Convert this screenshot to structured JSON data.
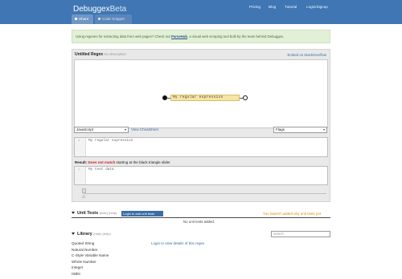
{
  "header": {
    "brand_main": "Debuggex",
    "brand_beta": "Beta",
    "nav": [
      "Pricing",
      "Blog",
      "Tutorial",
      "Login/Signup"
    ],
    "tabs": {
      "share": "Share",
      "code": "Code Snippet"
    }
  },
  "promo": {
    "before": "Using regexes for extracting data from web pages? Check out ",
    "link": "ParseHub",
    "after": ", a visual web scraping tool built by the team behind Debuggex."
  },
  "regex_panel": {
    "title": "Untitled Regex",
    "description": "No description",
    "embed_link": "Embed on StackOverflow",
    "railroad_text": "My regular expression",
    "flavor": "JavaScript",
    "cheatsheet": "View Cheatsheet",
    "flags": "Flags",
    "line_number": "1",
    "regex_text": "My regular expression",
    "result_label": "Result:",
    "result_status": "Does not match",
    "result_suffix": " starting at the black triangle slider",
    "test_text": "My test data"
  },
  "unit_tests": {
    "title": "Unit Tests",
    "help": "(hide) (help)",
    "add_button": "Login to add unit tests",
    "warning": "You haven't added any unit tests yet",
    "empty_text": "No unit tests added."
  },
  "library": {
    "title": "Library",
    "help": "(hide) (help)",
    "search_placeholder": "search",
    "hint": "Login to view details of this regex",
    "items": [
      "Quoted String",
      "Natural Number",
      "C-Style Variable Name",
      "Whole Number",
      "Integer",
      "ISBN"
    ]
  },
  "colors": {
    "header_bg": "#3f76b3",
    "promo_bg": "#e1f0d6",
    "fail_text": "#cc2222",
    "warning_text": "#e08a00",
    "link": "#3a6ea5"
  }
}
